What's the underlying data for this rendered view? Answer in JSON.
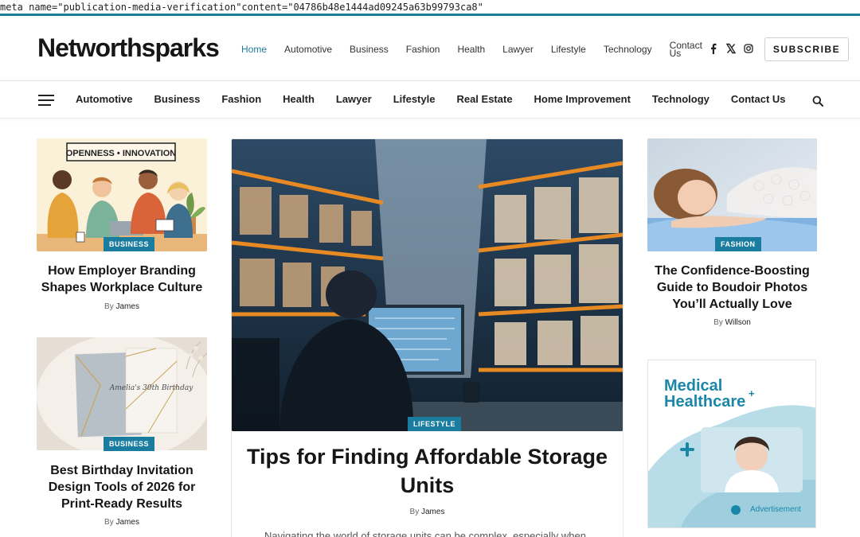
{
  "meta_text": "meta name=\"publication-media-verification\"content=\"04786b48e1444ad09245a63b99793ca8\"",
  "site": {
    "logo": "Networthsparks"
  },
  "top_nav": {
    "items": [
      "Home",
      "Automotive",
      "Business",
      "Fashion",
      "Health",
      "Lawyer",
      "Lifestyle",
      "Technology",
      "Contact Us"
    ],
    "active": "Home"
  },
  "socials": [
    "facebook-icon",
    "x-icon",
    "instagram-icon"
  ],
  "subscribe_label": "SUBSCRIBE",
  "secondary_nav": {
    "items": [
      "Automotive",
      "Business",
      "Fashion",
      "Health",
      "Lawyer",
      "Lifestyle",
      "Real Estate",
      "Home Improvement",
      "Technology",
      "Contact Us"
    ]
  },
  "cards": {
    "left_top": {
      "category": "BUSINESS",
      "title": "How Employer Branding Shapes Workplace Culture",
      "by": "By",
      "author": "James",
      "image_sign": "OPENNESS • INNOVATION"
    },
    "left_bottom": {
      "category": "BUSINESS",
      "title": "Best Birthday Invitation Design Tools of 2026 for Print-Ready Results",
      "by": "By",
      "author": "James",
      "image_text": "Amelia's 30th Birthday"
    },
    "feature": {
      "category": "LIFESTYLE",
      "title": "Tips for Finding Affordable Storage Units",
      "by": "By",
      "author": "James",
      "excerpt": "Navigating the world of storage units can be complex, especially when"
    },
    "right_top": {
      "category": "FASHION",
      "title": "The Confidence-Boosting Guide to Boudoir Photos You’ll Actually Love",
      "by": "By",
      "author": "Willson"
    }
  },
  "ad": {
    "headline_1": "Medical",
    "headline_2": "Healthcare",
    "plus": "+",
    "label": "Advertisement"
  },
  "colors": {
    "accent": "#1a7da0",
    "ad_teal": "#1a86a8"
  }
}
